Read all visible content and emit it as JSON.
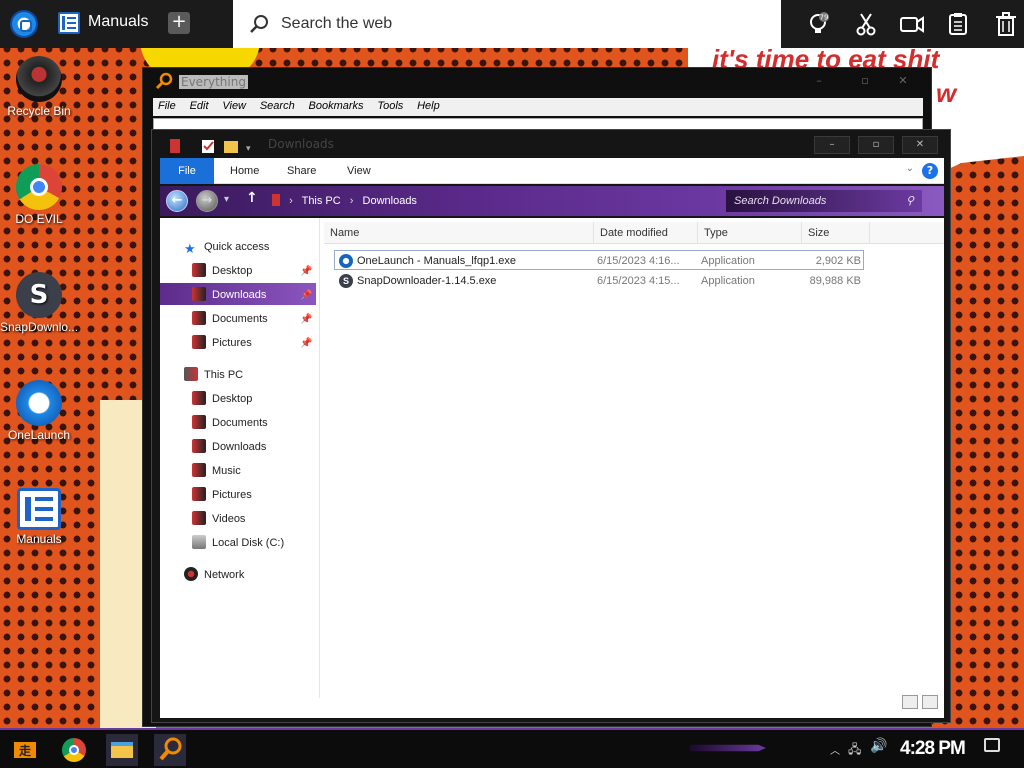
{
  "topbar": {
    "tab_label": "Manuals",
    "search_placeholder": "Search the web",
    "badge": "79",
    "icons": [
      "light-bulb-icon",
      "scissors-icon",
      "camera-icon",
      "clipboard-icon",
      "trash-icon"
    ]
  },
  "desktop": {
    "icons": [
      {
        "label": "Recycle Bin",
        "icon": "recycle-bin-icon"
      },
      {
        "label": "DO EVIL",
        "icon": "chrome-icon"
      },
      {
        "label": "SnapDownlo...",
        "icon": "snapdownloader-icon"
      },
      {
        "label": "OneLaunch",
        "icon": "onelaunch-icon"
      },
      {
        "label": "Manuals",
        "icon": "manuals-icon"
      }
    ],
    "comic_text": "it's time to eat shit",
    "comic_w": "w"
  },
  "everything": {
    "title": "Everything",
    "menu": [
      "File",
      "Edit",
      "View",
      "Search",
      "Bookmarks",
      "Tools",
      "Help"
    ]
  },
  "explorer": {
    "title": "Downloads",
    "ribbon_tabs": [
      "File",
      "Home",
      "Share",
      "View"
    ],
    "breadcrumb": [
      "This PC",
      "Downloads"
    ],
    "search_placeholder": "Search Downloads",
    "nav": {
      "quick_access": "Quick access",
      "quick_items": [
        "Desktop",
        "Downloads",
        "Documents",
        "Pictures"
      ],
      "this_pc": "This PC",
      "pc_items": [
        "Desktop",
        "Documents",
        "Downloads",
        "Music",
        "Pictures",
        "Videos",
        "Local Disk (C:)"
      ],
      "network": "Network"
    },
    "columns": [
      "Name",
      "Date modified",
      "Type",
      "Size"
    ],
    "files": [
      {
        "name": "OneLaunch - Manuals_lfqp1.exe",
        "date": "6/15/2023 4:16...",
        "type": "Application",
        "size": "2,902 KB",
        "icon": "onelaunch-icon"
      },
      {
        "name": "SnapDownloader-1.14.5.exe",
        "date": "6/15/2023 4:15...",
        "type": "Application",
        "size": "89,988 KB",
        "icon": "snapdownloader-icon"
      }
    ]
  },
  "taskbar": {
    "clock": "4:28 PM"
  },
  "colors": {
    "accent_purple": "#6b3aa0",
    "file_tab_blue": "#1a6fd8",
    "desktop_orange": "#e0541e"
  }
}
